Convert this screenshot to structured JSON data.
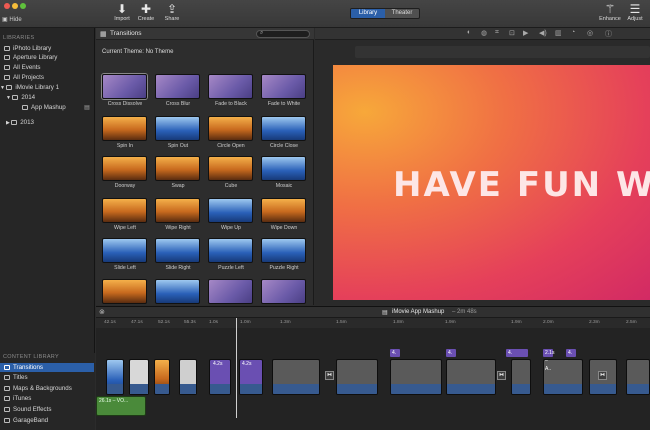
{
  "toolbar": {
    "hide_label": "Hide",
    "import_label": "Import",
    "create_label": "Create",
    "share_label": "Share",
    "seg_library": "Library",
    "seg_theater": "Theater",
    "enhance_label": "Enhance",
    "adjust_label": "Adjust"
  },
  "sidebar": {
    "libraries_header": "LIBRARIES",
    "items": [
      {
        "label": "iPhoto Library"
      },
      {
        "label": "Aperture Library"
      },
      {
        "label": "All Events"
      },
      {
        "label": "All Projects"
      },
      {
        "label": "iMovie Library 1"
      },
      {
        "label": "2014"
      },
      {
        "label": "App Mashup"
      },
      {
        "label": "2013"
      }
    ],
    "content_library_header": "CONTENT LIBRARY",
    "content_items": [
      {
        "label": "Transitions"
      },
      {
        "label": "Titles"
      },
      {
        "label": "Maps & Backgrounds"
      },
      {
        "label": "iTunes"
      },
      {
        "label": "Sound Effects"
      },
      {
        "label": "GarageBand"
      }
    ]
  },
  "browser": {
    "title": "Transitions",
    "theme": "Current Theme: No Theme",
    "transitions": [
      {
        "label": "Cross Dissolve"
      },
      {
        "label": "Cross Blur"
      },
      {
        "label": "Fade to Black"
      },
      {
        "label": "Fade to White"
      },
      {
        "label": "Spin In"
      },
      {
        "label": "Spin Out"
      },
      {
        "label": "Circle Open"
      },
      {
        "label": "Circle Close"
      },
      {
        "label": "Doorway"
      },
      {
        "label": "Swap"
      },
      {
        "label": "Cube"
      },
      {
        "label": "Mosaic"
      },
      {
        "label": "Wipe Left"
      },
      {
        "label": "Wipe Right"
      },
      {
        "label": "Wipe Up"
      },
      {
        "label": "Wipe Down"
      },
      {
        "label": "Slide Left"
      },
      {
        "label": "Slide Right"
      },
      {
        "label": "Puzzle Left"
      },
      {
        "label": "Puzzle Right"
      },
      {
        "label": ""
      },
      {
        "label": ""
      },
      {
        "label": ""
      },
      {
        "label": ""
      }
    ]
  },
  "viewer": {
    "preview_text": "HAVE FUN WiTH"
  },
  "timeline": {
    "project_title": "iMovie App Mashup",
    "duration": "– 2m 48s",
    "ticks": [
      "42.1s",
      "47.1s",
      "52.1s",
      "55.3s",
      "1.0s",
      "1.0m",
      "1.3m",
      "1.5m",
      "1.8m",
      "1.9m",
      "1.9m",
      "2.0m",
      "2.3m",
      "2.5m"
    ],
    "audio_clip": "26.1s – VO...",
    "title_clips": [
      "4.",
      "4.",
      "4.",
      "2.1s – A..",
      "4."
    ],
    "clip_labels": [
      "4.2s",
      "4.2s"
    ]
  }
}
